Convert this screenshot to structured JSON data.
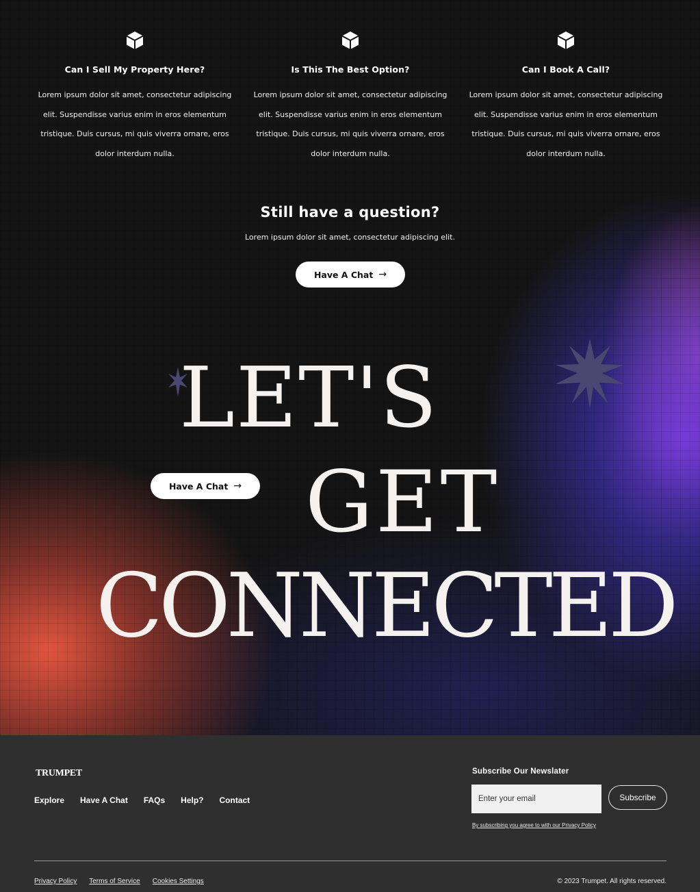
{
  "faq": [
    {
      "icon": "cube-icon",
      "title": "Can I Sell My Property Here?",
      "text": "Lorem ipsum dolor sit amet, consectetur adipiscing elit. Suspendisse varius enim in eros elementum tristique. Duis cursus, mi quis viverra ornare, eros dolor interdum nulla."
    },
    {
      "icon": "cube-icon",
      "title": "Is This The Best Option?",
      "text": "Lorem ipsum dolor sit amet, consectetur adipiscing elit. Suspendisse varius enim in eros elementum tristique. Duis cursus, mi quis viverra ornare, eros dolor interdum nulla."
    },
    {
      "icon": "cube-icon",
      "title": "Can I Book A Call?",
      "text": "Lorem ipsum dolor sit amet, consectetur adipiscing elit. Suspendisse varius enim in eros elementum tristique. Duis cursus, mi quis viverra ornare, eros dolor interdum nulla."
    }
  ],
  "question": {
    "title": "Still have a question?",
    "text": "Lorem ipsum dolor sit amet, consectetur adipiscing elit.",
    "button_label": "Have A Chat",
    "button_icon": "arrow-right-icon"
  },
  "cta": {
    "headline_line1": "LET'S",
    "headline_line2": "GET",
    "headline_line3": "CONNECTED",
    "button_label": "Have A Chat",
    "button_icon": "arrow-right-icon",
    "decoration_icon": "star-icon"
  },
  "footer": {
    "logo": "TRUMPET",
    "nav": [
      "Explore",
      "Have A Chat",
      "FAQs",
      "Help?",
      "Contact"
    ],
    "newsletter_title": "Subscribe Our Newslater",
    "email_placeholder": "Enter your email",
    "subscribe_label": "Subscribe",
    "disclaimer": "By subscribing you agree to with our Privacy Policy",
    "legal": [
      "Privacy Policy",
      "Terms of Service",
      "Cookies Settings"
    ],
    "copyright": "© 2023 Trumpet. All rights reserved."
  },
  "colors": {
    "background": "#141414",
    "footer_background": "#2f2f2f",
    "gradient_orange": "#ec5840",
    "gradient_purple": "#6a3ee0",
    "gradient_pink": "#cd50aa",
    "star": "#4a4870"
  }
}
